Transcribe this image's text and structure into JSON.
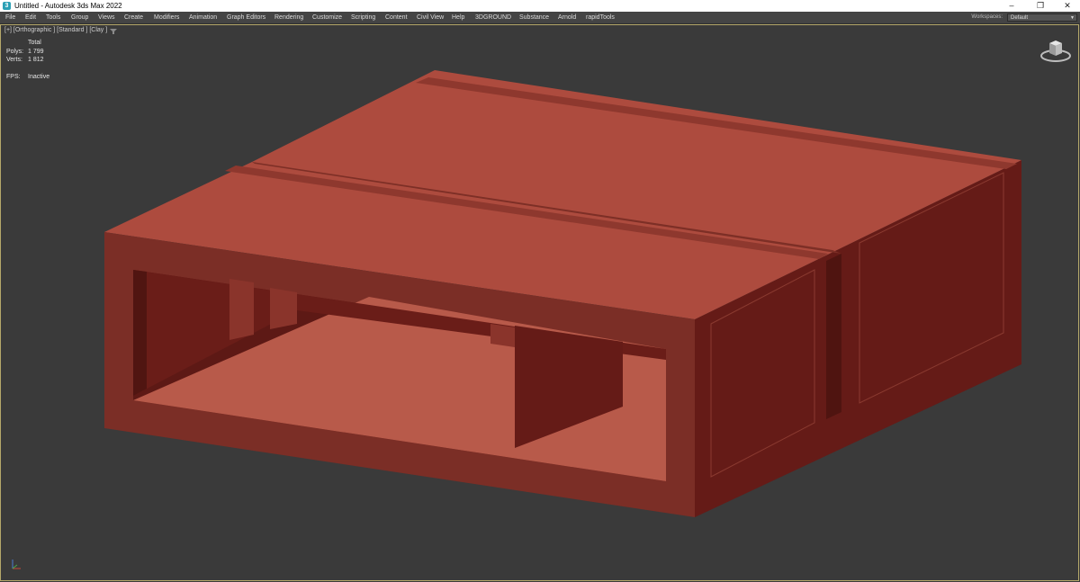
{
  "window": {
    "title": "Untitled - Autodesk 3ds Max 2022",
    "minimize": "–",
    "restore": "❐",
    "close": "✕"
  },
  "menu": [
    "File",
    "Edit",
    "Tools",
    "Group",
    "Views",
    "Create",
    "Modifiers",
    "Animation",
    "Graph Editors",
    "Rendering",
    "Customize",
    "Scripting",
    "Content",
    "Civil View",
    "Help",
    "3DGROUND",
    "Substance",
    "Arnold",
    "rapidTools"
  ],
  "workspaces": {
    "label": "Workspaces:",
    "value": "Default"
  },
  "viewport": {
    "label": "[+] [Orthographic ] [Standard ] [Clay ]",
    "stats": {
      "header": "Total",
      "polys_label": "Polys:",
      "polys": "1 799",
      "verts_label": "Verts:",
      "verts": "1 812",
      "fps_label": "FPS:",
      "fps": "Inactive"
    }
  },
  "colors": {
    "model_top": "#ad4b3e",
    "model_front": "#7b2e26",
    "model_side": "#651b17",
    "model_inner": "#b85a4a",
    "viewport_bg": "#3a3a3a"
  },
  "icons": [
    "viewcube-icon",
    "axis-tripod-icon",
    "viewport-filter-icon"
  ]
}
